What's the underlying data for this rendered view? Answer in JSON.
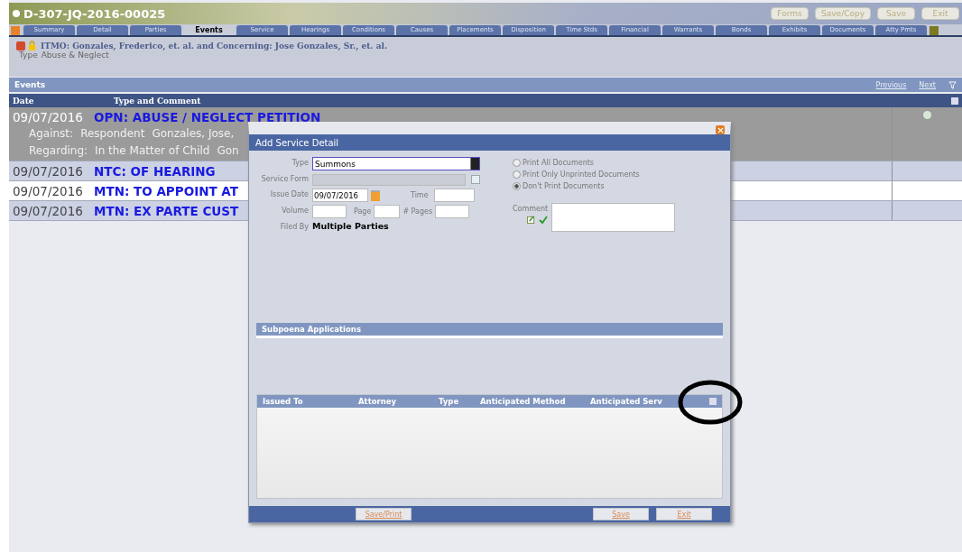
{
  "case": {
    "title": "D-307-JQ-2016-00025",
    "header_buttons": [
      "Forms",
      "Save/Copy",
      "Save",
      "Exit"
    ],
    "tabs": [
      {
        "label": "Summary",
        "selected": false
      },
      {
        "label": "Detail",
        "selected": false
      },
      {
        "label": "Parties",
        "selected": false
      },
      {
        "label": "Events",
        "selected": true
      },
      {
        "label": "Service",
        "selected": false
      },
      {
        "label": "Hearings",
        "selected": false
      },
      {
        "label": "Conditions",
        "selected": false
      },
      {
        "label": "Causes",
        "selected": false
      },
      {
        "label": "Placements",
        "selected": false
      },
      {
        "label": "Disposition",
        "selected": false
      },
      {
        "label": "Time Stds",
        "selected": false
      },
      {
        "label": "Financial",
        "selected": false
      },
      {
        "label": "Warrants",
        "selected": false
      },
      {
        "label": "Bonds",
        "selected": false
      },
      {
        "label": "Exhibits",
        "selected": false
      },
      {
        "label": "Documents",
        "selected": false
      },
      {
        "label": "Atty Pmts",
        "selected": false
      }
    ],
    "caption": "ITMO: Gonzales, Frederico, et. al. and Concerning: Jose Gonzales, Sr., et. al.",
    "type_label": "Type",
    "type_value": "Abuse & Neglect"
  },
  "events": {
    "title": "Events",
    "nav": [
      "Previous",
      "Next"
    ],
    "columns": [
      "Date",
      "Type and Comment"
    ],
    "rows": [
      {
        "date": "09/07/2016",
        "title": "OPN: ABUSE / NEGLECT PETITION",
        "expanded": true,
        "details": [
          {
            "label": "Against:",
            "values": [
              "Respondent",
              "Gonzales, Jose,"
            ]
          },
          {
            "label": "Regarding:",
            "values": [
              "In the Matter of Child",
              "Gon"
            ]
          }
        ]
      },
      {
        "date": "09/07/2016",
        "title": "NTC: OF HEARING",
        "expanded": false
      },
      {
        "date": "09/07/2016",
        "title": "MTN: TO APPOINT AT",
        "expanded": false
      },
      {
        "date": "09/07/2016",
        "title": "MTN: EX PARTE CUST",
        "expanded": false
      }
    ]
  },
  "dialog": {
    "title": "Add Service Detail",
    "type": {
      "label": "Type",
      "value": "Summons"
    },
    "service_form": {
      "label": "Service Form",
      "disabled": true
    },
    "issue_date": {
      "label": "Issue Date",
      "value": "09/07/2016"
    },
    "time": {
      "label": "Time"
    },
    "volume": {
      "label": "Volume"
    },
    "page": {
      "label": "Page"
    },
    "pages": {
      "label": "# Pages"
    },
    "filed_by": {
      "label": "Filed By",
      "value": "Multiple Parties"
    },
    "print_options": [
      {
        "label": "Print All Documents",
        "selected": false
      },
      {
        "label": "Print Only Unprinted Documents",
        "selected": false
      },
      {
        "label": "Don't Print Documents",
        "selected": true
      }
    ],
    "comment_label": "Comment",
    "subpoena_title": "Subpoena Applications",
    "columns": [
      "Issued To",
      "Attorney",
      "Type",
      "Anticipated Method",
      "Anticipated Serv"
    ],
    "buttons": {
      "left": [
        "Save/Print"
      ],
      "right": [
        "Save",
        "Exit"
      ]
    }
  }
}
